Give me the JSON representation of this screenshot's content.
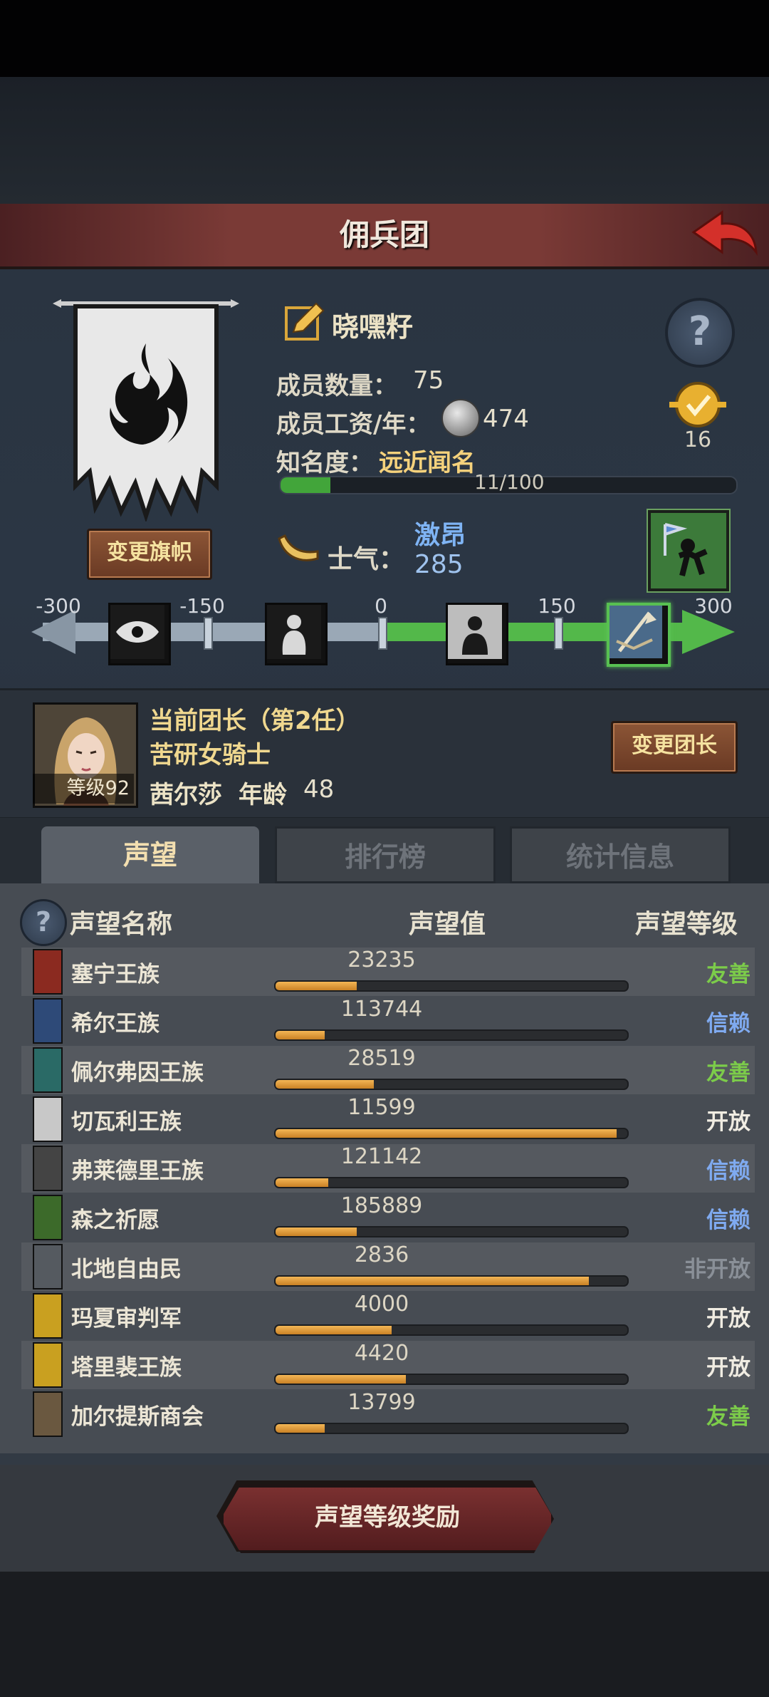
{
  "header": {
    "title": "佣兵团"
  },
  "guild": {
    "name": "晓嘿籽",
    "members_label": "成员数量：",
    "members_value": "75",
    "salary_label": "成员工资/年：",
    "salary_value": "474",
    "fame_label": "知名度：",
    "fame_value": "远近闻名",
    "fame_progress_text": "11/100",
    "fame_progress_fraction": 0.11,
    "change_flag_label": "变更旗帜",
    "medal_count": "16"
  },
  "morale": {
    "label": "士气：",
    "state": "激昂",
    "value": "285",
    "scale_ticks": [
      "-300",
      "-150",
      "0",
      "150",
      "300"
    ]
  },
  "leader": {
    "title": "当前团长（第2任）",
    "class": "苦研女骑士",
    "name": "茜尔莎",
    "age_label": "年龄",
    "age": "48",
    "level_label": "等级92",
    "change_label": "变更团长"
  },
  "tabs": [
    {
      "label": "声望",
      "active": true
    },
    {
      "label": "排行榜",
      "active": false
    },
    {
      "label": "统计信息",
      "active": false
    }
  ],
  "reputation": {
    "col_name": "声望名称",
    "col_value": "声望值",
    "col_level": "声望等级",
    "rows": [
      {
        "name": "塞宁王族",
        "value": "23235",
        "fill": 0.23,
        "level": "友善",
        "level_color": "#7ccc4a",
        "icon_color": "#8b2a20"
      },
      {
        "name": "希尔王族",
        "value": "113744",
        "fill": 0.14,
        "level": "信赖",
        "level_color": "#7faaf0",
        "icon_color": "#2e4a78"
      },
      {
        "name": "佩尔弗因王族",
        "value": "28519",
        "fill": 0.28,
        "level": "友善",
        "level_color": "#7ccc4a",
        "icon_color": "#2a6a66"
      },
      {
        "name": "切瓦利王族",
        "value": "11599",
        "fill": 0.97,
        "level": "开放",
        "level_color": "#f0ece2",
        "icon_color": "#c8c8c8"
      },
      {
        "name": "弗莱德里王族",
        "value": "121142",
        "fill": 0.15,
        "level": "信赖",
        "level_color": "#7faaf0",
        "icon_color": "#444444"
      },
      {
        "name": "森之祈愿",
        "value": "185889",
        "fill": 0.23,
        "level": "信赖",
        "level_color": "#7faaf0",
        "icon_color": "#3c6a2a"
      },
      {
        "name": "北地自由民",
        "value": "2836",
        "fill": 0.89,
        "level": "非开放",
        "level_color": "#8a9098",
        "icon_color": "#555a60"
      },
      {
        "name": "玛夏审判军",
        "value": "4000",
        "fill": 0.33,
        "level": "开放",
        "level_color": "#f0ece2",
        "icon_color": "#c9a020"
      },
      {
        "name": "塔里裴王族",
        "value": "4420",
        "fill": 0.37,
        "level": "开放",
        "level_color": "#f0ece2",
        "icon_color": "#c9a020"
      },
      {
        "name": "加尔提斯商会",
        "value": "13799",
        "fill": 0.14,
        "level": "友善",
        "level_color": "#7ccc4a",
        "icon_color": "#6a5840"
      }
    ]
  },
  "reward_button": {
    "label": "声望等级奖励"
  },
  "colors": {
    "accent_gold": "#f0d88f",
    "positive_green": "#53b84a",
    "header_red": "#7a3a36"
  }
}
